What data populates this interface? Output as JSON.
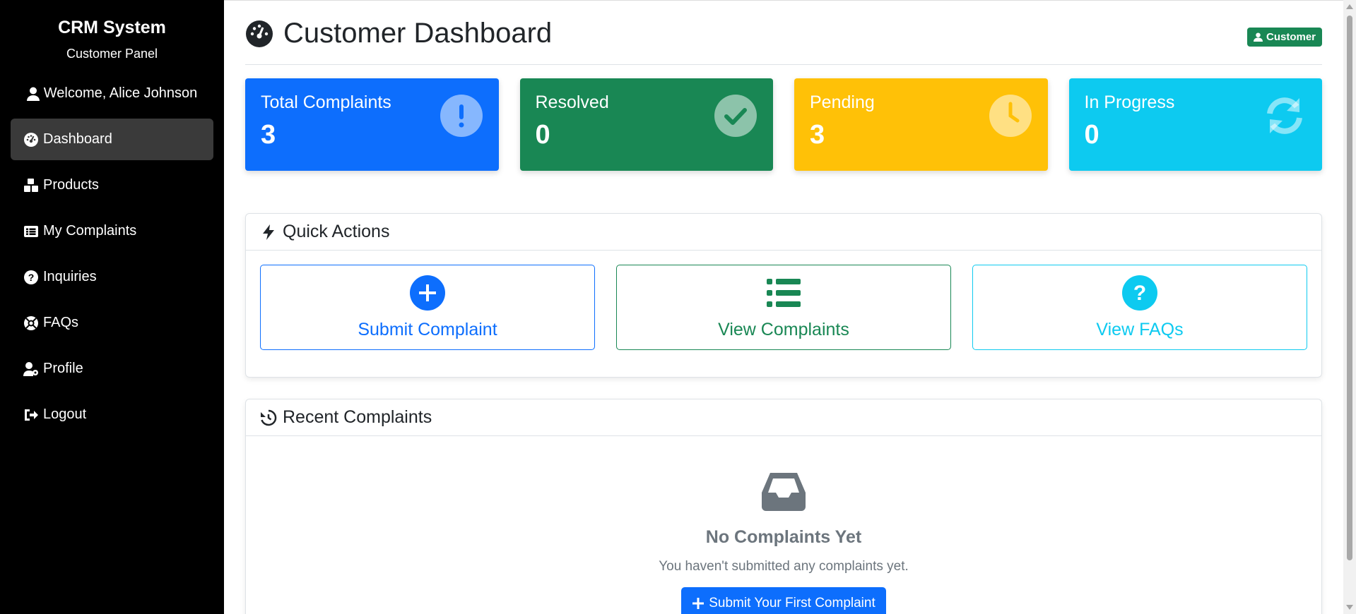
{
  "sidebar": {
    "brand_title": "CRM System",
    "brand_subtitle": "Customer Panel",
    "welcome": "Welcome, Alice Johnson",
    "items": [
      {
        "label": "Dashboard",
        "icon": "gauge-icon",
        "active": true
      },
      {
        "label": "Products",
        "icon": "boxes-icon",
        "active": false
      },
      {
        "label": "My Complaints",
        "icon": "list-alt-icon",
        "active": false
      },
      {
        "label": "Inquiries",
        "icon": "question-circle-icon",
        "active": false
      },
      {
        "label": "FAQs",
        "icon": "life-ring-icon",
        "active": false
      },
      {
        "label": "Profile",
        "icon": "user-cog-icon",
        "active": false
      },
      {
        "label": "Logout",
        "icon": "sign-out-icon",
        "active": false
      }
    ]
  },
  "header": {
    "title": "Customer Dashboard",
    "role_badge": "Customer"
  },
  "stats": [
    {
      "label": "Total Complaints",
      "value": "3",
      "color": "#0d6efd",
      "icon": "exclamation-circle-icon"
    },
    {
      "label": "Resolved",
      "value": "0",
      "color": "#198754",
      "icon": "check-circle-icon"
    },
    {
      "label": "Pending",
      "value": "3",
      "color": "#ffc107",
      "icon": "clock-icon"
    },
    {
      "label": "In Progress",
      "value": "0",
      "color": "#0dcaf0",
      "icon": "sync-icon"
    }
  ],
  "quick_actions": {
    "title": "Quick Actions",
    "buttons": [
      {
        "label": "Submit Complaint",
        "icon": "plus-circle-icon",
        "color": "#0d6efd"
      },
      {
        "label": "View Complaints",
        "icon": "list-icon",
        "color": "#198754"
      },
      {
        "label": "View FAQs",
        "icon": "question-circle-icon",
        "color": "#0dcaf0"
      }
    ]
  },
  "recent_complaints": {
    "title": "Recent Complaints",
    "empty_title": "No Complaints Yet",
    "empty_text": "You haven't submitted any complaints yet.",
    "cta_label": "Submit Your First Complaint"
  }
}
